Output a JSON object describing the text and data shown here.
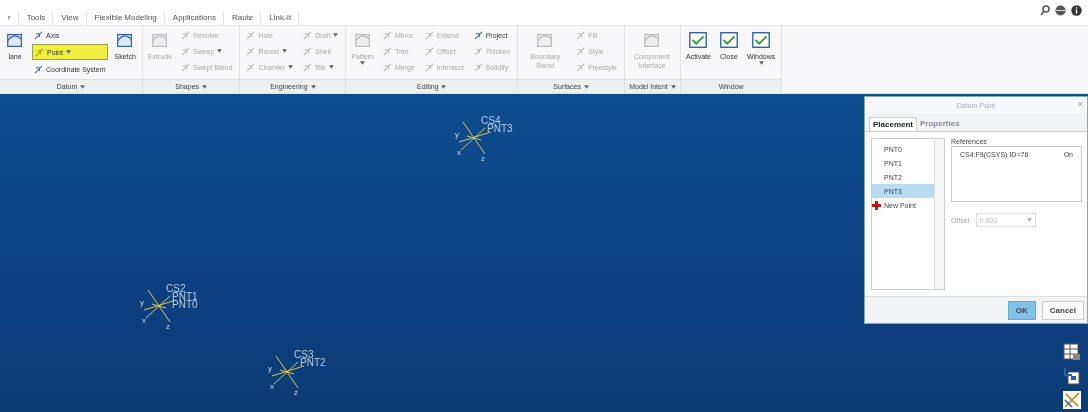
{
  "tabs": [
    {
      "label": "r",
      "selected": false
    },
    {
      "label": "Tools",
      "selected": false
    },
    {
      "label": "View",
      "selected": false
    },
    {
      "label": "Flexible Modeling",
      "selected": false
    },
    {
      "label": "Applications",
      "selected": false
    },
    {
      "label": "Raute",
      "selected": false
    },
    {
      "label": "Link-It",
      "selected": false
    }
  ],
  "ribbon": [
    {
      "label": "Datum",
      "dropdown": true,
      "columns": [
        [
          {
            "label": "lane",
            "kind": "large",
            "disabled": false,
            "dropdown": false,
            "selected": false
          }
        ],
        [
          {
            "label": "Axis",
            "kind": "small",
            "disabled": false,
            "dropdown": false,
            "selected": false
          },
          {
            "label": "Point",
            "kind": "small",
            "disabled": false,
            "dropdown": true,
            "selected": true
          },
          {
            "label": "Coordinate System",
            "kind": "small",
            "disabled": false,
            "dropdown": false,
            "selected": false
          }
        ],
        [
          {
            "label": "Sketch",
            "kind": "large",
            "disabled": false,
            "dropdown": false,
            "selected": false
          }
        ]
      ]
    },
    {
      "label": "Shapes",
      "dropdown": true,
      "columns": [
        [
          {
            "label": "Extrude",
            "kind": "large",
            "disabled": true,
            "dropdown": false,
            "selected": false
          }
        ],
        [
          {
            "label": "Revolve",
            "kind": "small",
            "disabled": true,
            "dropdown": false,
            "selected": false
          },
          {
            "label": "Sweep",
            "kind": "small",
            "disabled": true,
            "dropdown": true,
            "selected": false
          },
          {
            "label": "Swept Blend",
            "kind": "small",
            "disabled": true,
            "dropdown": false,
            "selected": false
          }
        ]
      ]
    },
    {
      "label": "Engineering",
      "dropdown": true,
      "columns": [
        [
          {
            "label": "Hole",
            "kind": "small",
            "disabled": true,
            "dropdown": false,
            "selected": false
          },
          {
            "label": "Round",
            "kind": "small",
            "disabled": true,
            "dropdown": true,
            "selected": false
          },
          {
            "label": "Chamfer",
            "kind": "small",
            "disabled": true,
            "dropdown": true,
            "selected": false
          }
        ],
        [
          {
            "label": "Draft",
            "kind": "small",
            "disabled": true,
            "dropdown": true,
            "selected": false
          },
          {
            "label": "Shell",
            "kind": "small",
            "disabled": true,
            "dropdown": false,
            "selected": false
          },
          {
            "label": "Rib",
            "kind": "small",
            "disabled": true,
            "dropdown": true,
            "selected": false
          }
        ]
      ]
    },
    {
      "label": "Editing",
      "dropdown": true,
      "columns": [
        [
          {
            "label": "Pattern",
            "kind": "large",
            "disabled": true,
            "dropdown": true,
            "selected": false
          }
        ],
        [
          {
            "label": "Mirror",
            "kind": "small",
            "disabled": true,
            "dropdown": false,
            "selected": false
          },
          {
            "label": "Trim",
            "kind": "small",
            "disabled": true,
            "dropdown": false,
            "selected": false
          },
          {
            "label": "Merge",
            "kind": "small",
            "disabled": true,
            "dropdown": false,
            "selected": false
          }
        ],
        [
          {
            "label": "Extend",
            "kind": "small",
            "disabled": true,
            "dropdown": false,
            "selected": false
          },
          {
            "label": "Offset",
            "kind": "small",
            "disabled": true,
            "dropdown": false,
            "selected": false
          },
          {
            "label": "Intersect",
            "kind": "small",
            "disabled": true,
            "dropdown": false,
            "selected": false
          }
        ],
        [
          {
            "label": "Project",
            "kind": "small",
            "disabled": false,
            "dropdown": false,
            "selected": false
          },
          {
            "label": "Thicken",
            "kind": "small",
            "disabled": true,
            "dropdown": false,
            "selected": false
          },
          {
            "label": "Solidify",
            "kind": "small",
            "disabled": true,
            "dropdown": false,
            "selected": false
          }
        ]
      ]
    },
    {
      "label": "Surfaces",
      "dropdown": true,
      "columns": [
        [
          {
            "label": "Boundary Blend",
            "kind": "large",
            "disabled": true,
            "dropdown": false,
            "selected": false
          }
        ],
        [
          {
            "label": "Fill",
            "kind": "small",
            "disabled": true,
            "dropdown": false,
            "selected": false
          },
          {
            "label": "Style",
            "kind": "small",
            "disabled": true,
            "dropdown": false,
            "selected": false
          },
          {
            "label": "Freestyle",
            "kind": "small",
            "disabled": true,
            "dropdown": false,
            "selected": false
          }
        ]
      ]
    },
    {
      "label": "Model Intent",
      "dropdown": true,
      "columns": [
        [
          {
            "label": "Component Interface",
            "kind": "large",
            "disabled": true,
            "dropdown": false,
            "selected": false
          }
        ]
      ]
    },
    {
      "label": "Window",
      "dropdown": false,
      "columns": [
        [
          {
            "label": "Activate",
            "kind": "large",
            "disabled": false,
            "dropdown": false,
            "selected": false
          }
        ],
        [
          {
            "label": "Close",
            "kind": "large",
            "disabled": false,
            "dropdown": false,
            "selected": false
          }
        ],
        [
          {
            "label": "Windows",
            "kind": "large",
            "disabled": false,
            "dropdown": true,
            "selected": false
          }
        ]
      ]
    }
  ],
  "canvas": {
    "markers": [
      {
        "labels": [
          "CS4",
          "PNT3"
        ],
        "axes": [
          "y",
          "x",
          "z"
        ]
      },
      {
        "labels": [
          "CS2",
          "PNT1",
          "PNT0"
        ],
        "axes": [
          "y",
          "x",
          "z"
        ]
      },
      {
        "labels": [
          "CS3",
          "PNT2"
        ],
        "axes": [
          "y",
          "x",
          "z"
        ]
      }
    ]
  },
  "dialog": {
    "title": "Datum Point",
    "close": "×",
    "tabs": [
      {
        "label": "Placement",
        "selected": true
      },
      {
        "label": "Properties",
        "selected": false
      }
    ],
    "points": [
      {
        "label": "PNT0",
        "selected": false,
        "kind": "point"
      },
      {
        "label": "PNT1",
        "selected": false,
        "kind": "point"
      },
      {
        "label": "PNT2",
        "selected": false,
        "kind": "point"
      },
      {
        "label": "PNT3",
        "selected": true,
        "kind": "point"
      },
      {
        "label": "New Point",
        "selected": false,
        "kind": "new"
      }
    ],
    "references_label": "References",
    "references": [
      {
        "name": "CS4:F9(CSYS) ID=76",
        "constraint": "On"
      }
    ],
    "offset_label": "Offset",
    "offset_value": "0.000",
    "offset_disabled": true,
    "buttons": [
      {
        "label": "OK",
        "primary": true
      },
      {
        "label": "Cancel",
        "primary": false
      }
    ]
  }
}
